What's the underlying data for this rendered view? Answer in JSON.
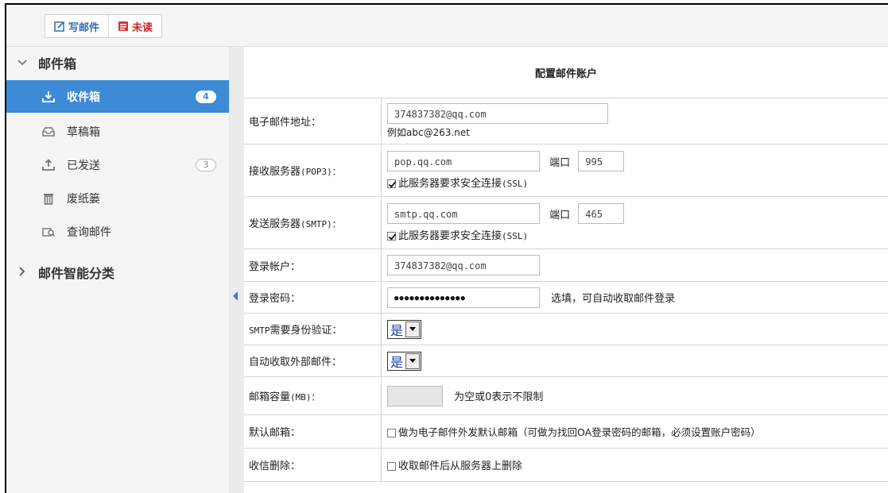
{
  "toolbar": {
    "compose_label": "写邮件",
    "unread_label": "未读"
  },
  "sidebar": {
    "mailbox_section": "邮件箱",
    "items": [
      {
        "label": "收件箱",
        "badge": "4",
        "icon": "download-tray-icon",
        "active": true
      },
      {
        "label": "草稿箱",
        "icon": "drafts-tray-icon"
      },
      {
        "label": "已发送",
        "badge": "3",
        "icon": "upload-tray-icon"
      },
      {
        "label": "废纸篓",
        "icon": "trash-icon"
      },
      {
        "label": "查询邮件",
        "icon": "search-mail-icon"
      }
    ],
    "smart_section": "邮件智能分类"
  },
  "form": {
    "title": "配置邮件账户",
    "email": {
      "label": "电子邮件地址：",
      "value": "374837382@qq.com",
      "hint": "例如abc@263.net"
    },
    "pop3": {
      "label": "接收服务器",
      "label_suffix": "(POP3)：",
      "value": "pop.qq.com",
      "port_label": "端口",
      "port": "995",
      "ssl_label": "此服务器要求安全连接",
      "ssl_suffix": "(SSL)"
    },
    "smtp": {
      "label": "发送服务器",
      "label_suffix": "(SMTP)：",
      "value": "smtp.qq.com",
      "port_label": "端口",
      "port": "465",
      "ssl_label": "此服务器要求安全连接",
      "ssl_suffix": "(SSL)"
    },
    "login_account": {
      "label": "登录帐户：",
      "value": "374837382@qq.com"
    },
    "password": {
      "label": "登录密码：",
      "value": "●●●●●●●●●●●●●●",
      "note": "选填，可自动收取邮件登录"
    },
    "smtp_auth": {
      "label_prefix": "SMTP",
      "label": "需要身份验证：",
      "value": "是"
    },
    "auto_fetch": {
      "label": "自动收取外部邮件：",
      "value": "是"
    },
    "capacity": {
      "label": "邮箱容量",
      "label_suffix": "(MB)：",
      "value": "",
      "note": "为空或0表示不限制"
    },
    "default_box": {
      "label": "默认邮箱：",
      "option": "做为电子邮件外发默认邮箱（可做为找回OA登录密码的邮箱，必须设置账户密码）"
    },
    "delete_after": {
      "label": "收信删除：",
      "option": "收取邮件后从服务器上删除"
    }
  },
  "colors": {
    "accent": "#3d8ad6",
    "unread": "#cc2222",
    "compose": "#2f6fb3"
  }
}
